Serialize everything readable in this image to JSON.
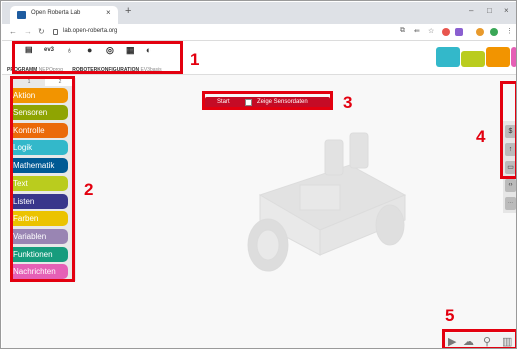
{
  "browser": {
    "tab_title": "Open Roberta Lab",
    "tab_close": "×",
    "new_tab": "+",
    "url": "lab.open-roberta.org",
    "window_min": "–",
    "window_max": "□",
    "window_close": "×"
  },
  "toolbar": {
    "items": [
      "ev3"
    ],
    "program_label": "PROGRAMM",
    "program_value": "NEPOprog",
    "config_label": "ROBOTERKONFIGURATION",
    "config_value": "EV3basis"
  },
  "sidebar": {
    "level_1": "1",
    "level_2": "2",
    "categories": [
      {
        "label": "Aktion",
        "color": "#f29400"
      },
      {
        "label": "Sensoren",
        "color": "#8fa402"
      },
      {
        "label": "Kontrolle",
        "color": "#eb6a0a"
      },
      {
        "label": "Logik",
        "color": "#33b8ca"
      },
      {
        "label": "Mathematik",
        "color": "#005a94"
      },
      {
        "label": "Text",
        "color": "#bacc1e"
      },
      {
        "label": "Listen",
        "color": "#39378b"
      },
      {
        "label": "Farben",
        "color": "#ebc300"
      },
      {
        "label": "Variablen",
        "color": "#9985b3"
      },
      {
        "label": "Funktionen",
        "color": "#179c7d"
      },
      {
        "label": "Nachrichten",
        "color": "#e560b6"
      }
    ]
  },
  "workspace": {
    "start_label": "Start",
    "sensor_label": "Zeige Sensordaten"
  },
  "callouts": [
    "1",
    "2",
    "3",
    "4",
    "5"
  ]
}
